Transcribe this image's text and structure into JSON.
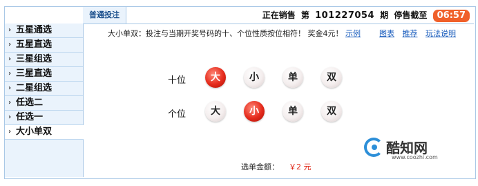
{
  "header": {
    "tab_label": "普通投注",
    "status": "正在销售",
    "issue_prefix": "第",
    "issue_number": "101227054",
    "issue_suffix": "期",
    "deadline_label": "停售截至",
    "countdown": "06:57",
    "countdown_color": "#f0602a"
  },
  "sidebar": {
    "items": [
      {
        "label": "五星通选"
      },
      {
        "label": "五星直选"
      },
      {
        "label": "三星组选"
      },
      {
        "label": "三星直选"
      },
      {
        "label": "二星组选"
      },
      {
        "label": "任选二"
      },
      {
        "label": "任选一"
      },
      {
        "label": "大小单双",
        "active": true
      }
    ]
  },
  "main": {
    "description": "大小单双：投注与当期开奖号码的十、个位性质按位相符！ 奖金4元！",
    "example_link": "示例",
    "links": {
      "chart": "图表",
      "recommend": "推荐",
      "rules": "玩法说明"
    },
    "rows": [
      {
        "label": "十位",
        "options": [
          "大",
          "小",
          "单",
          "双"
        ],
        "selected": "大"
      },
      {
        "label": "个位",
        "options": [
          "大",
          "小",
          "单",
          "双"
        ],
        "selected": "小"
      }
    ],
    "amount_label": "选单金额：",
    "amount_value": "￥2 元"
  },
  "watermark": {
    "name": "酷知网",
    "url": "www.coozhi.com"
  },
  "colors": {
    "accent": "#1a5dbd",
    "selected_ball": "#e52b1c",
    "sidebar_bg": "#eaf3fc"
  }
}
